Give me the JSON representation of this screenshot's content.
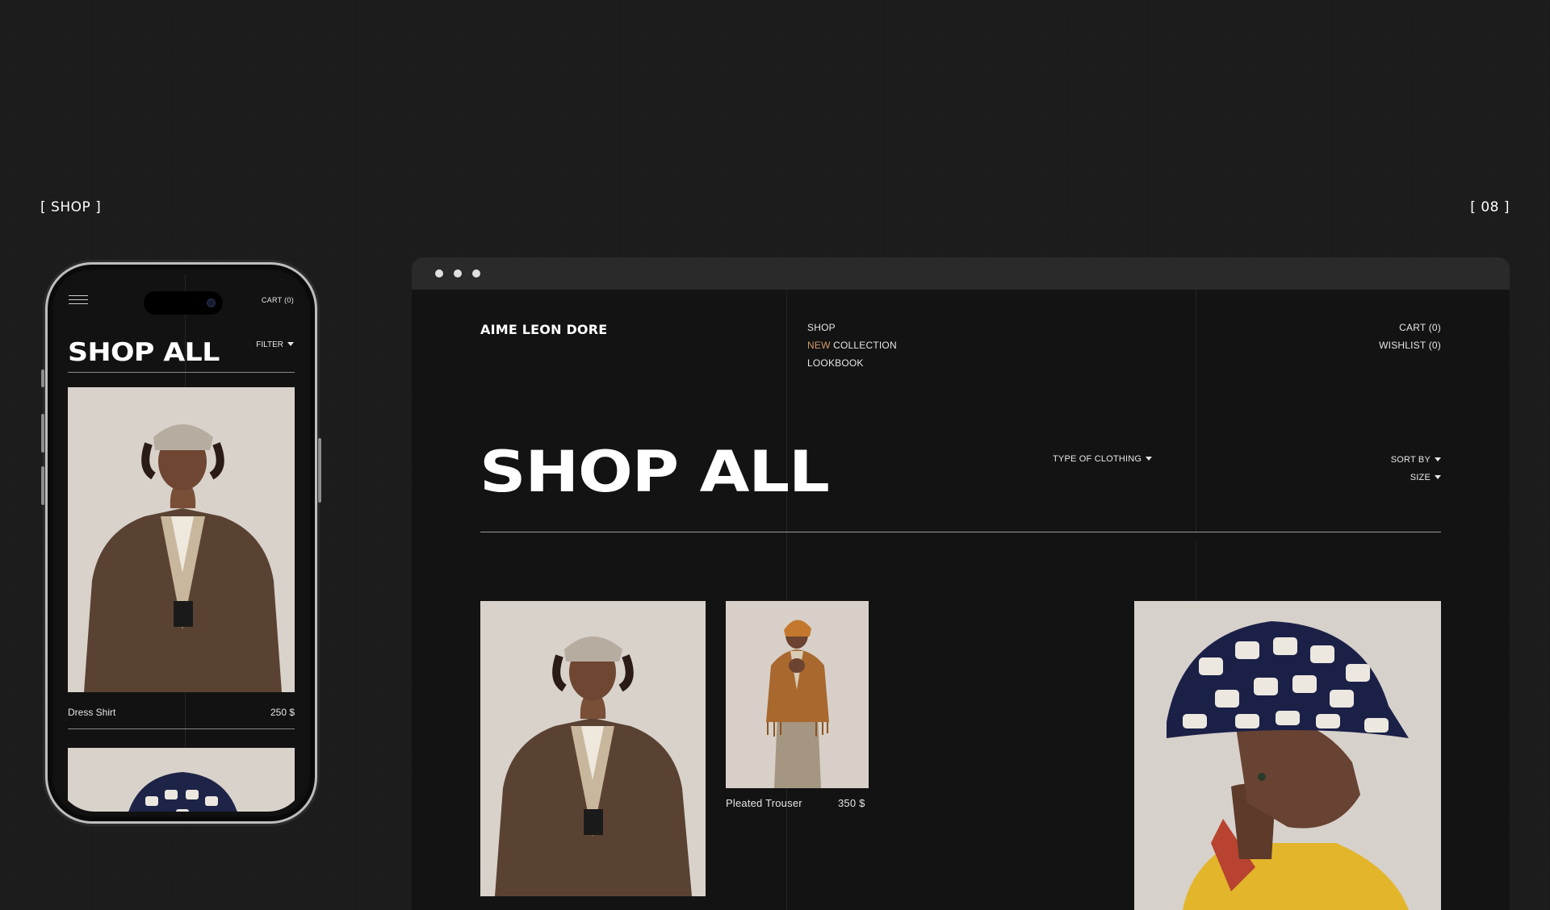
{
  "labels": {
    "left": "[ SHOP ]",
    "right": "[ 08 ]"
  },
  "phone": {
    "cart": "CART (0)",
    "title": "SHOP ALL",
    "filter": "FILTER",
    "product": {
      "name": "Dress Shirt",
      "price": "250 $"
    }
  },
  "browser": {
    "brand": "AIME LEON DORE",
    "nav": {
      "shop": "SHOP",
      "new_accent": "NEW",
      "collection": " COLLECTION",
      "lookbook": "LOOKBOOK"
    },
    "account": {
      "cart": "CART (0)",
      "wishlist": "WISHLIST (0)"
    },
    "title": "SHOP ALL",
    "filters": {
      "type": "TYPE OF CLOTHING",
      "sort": "SORT BY",
      "size": "SIZE"
    },
    "products": [
      {
        "name": "Pleated Trouser",
        "price": "350 $"
      }
    ]
  },
  "colors": {
    "background": "#1b1b1b",
    "panel": "#131313",
    "accent": "#d39a6a",
    "photo_bg": "#d9d2cb"
  }
}
